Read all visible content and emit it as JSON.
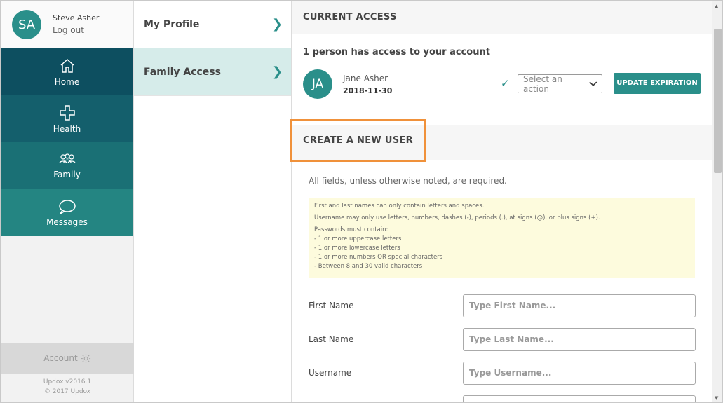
{
  "user": {
    "initials": "SA",
    "name": "Steve Asher",
    "logout": "Log out"
  },
  "sidebar": {
    "items": [
      {
        "label": "Home",
        "icon": "home-icon"
      },
      {
        "label": "Health",
        "icon": "health-icon"
      },
      {
        "label": "Family",
        "icon": "family-icon"
      },
      {
        "label": "Messages",
        "icon": "messages-icon"
      }
    ],
    "account": "Account",
    "version": "Updox v2016.1",
    "copyright": "© 2017 Updox"
  },
  "subnav": {
    "items": [
      {
        "label": "My Profile"
      },
      {
        "label": "Family Access"
      }
    ]
  },
  "current_access": {
    "title": "CURRENT ACCESS",
    "summary": "1 person has access to your account",
    "person": {
      "initials": "JA",
      "name": "Jane Asher",
      "date": "2018-11-30"
    },
    "select_placeholder": "Select an action",
    "update_button": "UPDATE EXPIRATION"
  },
  "new_user": {
    "title": "CREATE A NEW USER",
    "required_note": "All fields, unless otherwise noted, are required.",
    "rules": {
      "names": "First and last names can only contain letters and spaces.",
      "username": "Username may only use letters, numbers, dashes (-), periods (.), at signs (@), or plus signs (+).",
      "password_intro": "Passwords must contain:",
      "password_items": [
        "- 1 or more uppercase letters",
        "- 1 or more lowercase letters",
        "- 1 or more numbers OR special characters",
        "- Between 8 and 30 valid characters"
      ]
    },
    "fields": [
      {
        "label": "First Name",
        "placeholder": "Type First Name..."
      },
      {
        "label": "Last Name",
        "placeholder": "Type Last Name..."
      },
      {
        "label": "Username",
        "placeholder": "Type Username..."
      }
    ]
  },
  "colors": {
    "accent": "#2a8f8a",
    "highlight": "#f0913a"
  }
}
